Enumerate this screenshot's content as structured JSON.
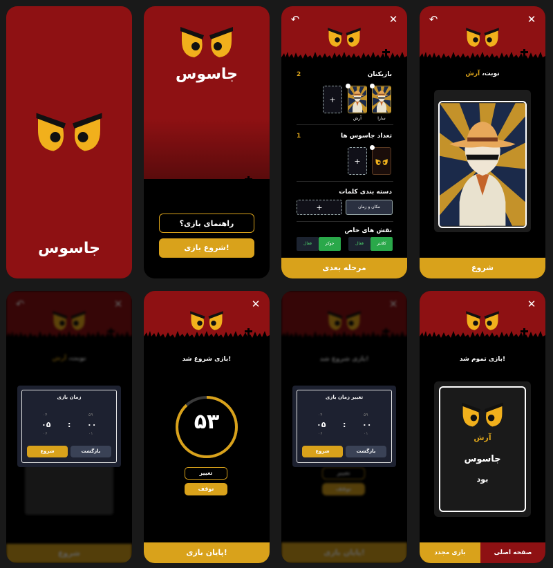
{
  "app": {
    "title": "جاسوس"
  },
  "colors": {
    "red": "#8e1113",
    "gold": "#d9a21b",
    "black": "#000000",
    "panel": "#1d2130"
  },
  "screens": {
    "splash": {
      "title": "جاسوس"
    },
    "home": {
      "title": "جاسوس",
      "guide_button": "راهنمای بازی؟",
      "start_button": "شروع بازی!"
    },
    "setup": {
      "players_title": "بازیکنان",
      "players_count": "2",
      "player_names": [
        "آرش",
        "سارا"
      ],
      "add_symbol": "+",
      "spies_title": "تعداد جاسوس ها",
      "spies_count": "1",
      "categories_title": "دسته بندی کلمات",
      "category_selected": "مکان و زمان",
      "special_roles_title": "نقش های خاص",
      "role_chips": [
        "کلانتر",
        "فعال",
        "جوکر",
        "فعال"
      ],
      "next_button": "مرحله بعدی"
    },
    "turn": {
      "turn_prefix": "نوبت،",
      "turn_name": "آرش",
      "start_button": "شروع"
    },
    "time_modal": {
      "background_turn_prefix": "نوبت،",
      "background_turn_name": "آرش",
      "background_button": "شروع",
      "title": "زمان بازی",
      "minutes": "۰۵",
      "seconds": "۰۰",
      "minutes_above": "۰۴",
      "minutes_below": "۰۶",
      "seconds_above": "۵۹",
      "seconds_below": "۰۱",
      "separator": ":",
      "start_button": "شروع",
      "back_button": "بازگشت"
    },
    "game": {
      "status": "بازی شروع شد!",
      "timer": "۵۳",
      "timer_fraction": 0.88,
      "change_button": "تغییر",
      "pause_button": "توقف",
      "end_button": "پایان بازی!"
    },
    "change_time": {
      "background_status": "بازی شروع شد!",
      "background_change": "تغییر",
      "background_pause": "توقف",
      "background_end": "پایان بازی!",
      "title": "تغییر زمان بازی",
      "minutes": "۰۵",
      "seconds": "۰۰",
      "minutes_above": "۰۴",
      "minutes_below": "۰۶",
      "seconds_above": "۵۹",
      "seconds_below": "۰۱",
      "separator": ":",
      "start_button": "شروع",
      "back_button": "بازگشت"
    },
    "result": {
      "status": "بازی تموم شد!",
      "name": "آرش",
      "role": "جاسوس",
      "was": "بود",
      "replay_button": "بازی مجدد",
      "home_button": "صفحه اصلی"
    }
  }
}
